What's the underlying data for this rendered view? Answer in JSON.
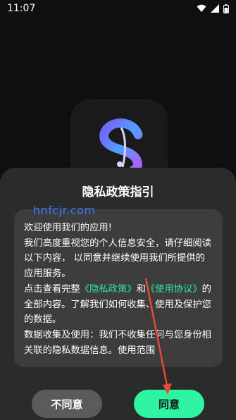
{
  "status_bar": {
    "time": "11:07"
  },
  "dialog": {
    "title": "隐私政策指引",
    "paragraphs": {
      "p1": "欢迎使用我们的应用!",
      "p2": "我们高度重视您的个人信息安全，请仔细阅读以下内容，  以同意并继续使用我们所提供的应用服务。",
      "p3_pre": "点击查看完整",
      "privacy_link": "《隐私政策》",
      "p3_and": "和",
      "terms_link": "《使用协议》",
      "p3_post": "的全部内容。了解我们如何收集、使用及保护您的数据。",
      "p4": "数据收集及使用：我们不收集任何与您身份相关联的隐私数据信息。使用范围"
    }
  },
  "watermark": "hnfcjr.com",
  "buttons": {
    "disagree": "不同意",
    "agree": "同意"
  },
  "colors": {
    "accent": "#2ef4a1",
    "link": "#2fe6a0",
    "annotation_arrow": "#e8483a"
  }
}
